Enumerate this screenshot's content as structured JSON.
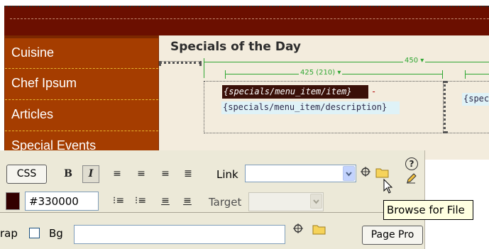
{
  "sidebar": {
    "items": [
      {
        "label": "Cuisine"
      },
      {
        "label": "Chef Ipsum"
      },
      {
        "label": "Articles"
      },
      {
        "label": "Special Events"
      }
    ]
  },
  "document": {
    "heading": "Specials of the Day",
    "table_width_label": "450",
    "column_width_label": "425 (210)",
    "item_tag": "{specials/menu_item/item}",
    "separator": "-",
    "description_tag": "{specials/menu_item/description}",
    "right_cell_tag": "{spec"
  },
  "properties": {
    "css_button": "CSS",
    "bold_glyph": "B",
    "italic_glyph": "I",
    "link_label": "Link",
    "link_value": "",
    "color_value": "#330000",
    "target_label": "Target",
    "target_value": "",
    "wrap_label": "rap",
    "bg_label": "Bg",
    "bg_value": "",
    "page_props_button": "Page Pro",
    "help_glyph": "?"
  },
  "tooltip": {
    "text": "Browse for File"
  },
  "colors": {
    "banner": "#6b0f00",
    "sidebar_item": "#a53d00",
    "content_bg": "#f3ecdd",
    "panel_bg": "#ece9d8",
    "guide_green": "#2fa632",
    "text_color_swatch": "#330000"
  },
  "icons": {
    "point_to_file": "crosshair-target-icon",
    "browse_folder": "folder-icon",
    "help": "help-icon",
    "edit": "pencil-edit-icon",
    "cursor": "mouse-pointer-icon"
  }
}
